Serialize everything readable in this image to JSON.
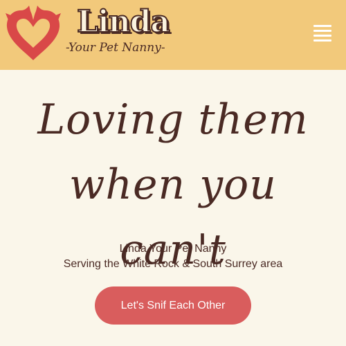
{
  "header": {
    "brand_name": "Linda",
    "tagline": "-Your Pet Nanny-",
    "logo_icon": "heart-cat-dog-logo-icon",
    "menu_icon": "hamburger-menu-icon"
  },
  "hero": {
    "title_line1": "Loving them",
    "title_line2": "when you can't"
  },
  "intro": {
    "line1": "Linda Your Pet Nanny",
    "line2": "Serving the White Rock & South Surrey area"
  },
  "cta": {
    "label": "Let's Snif Each Other"
  },
  "colors": {
    "header_bg": "#f2c97b",
    "page_bg": "#faf6ea",
    "heart": "#d94848",
    "text": "#4a2a24",
    "button": "#d95d5d"
  }
}
